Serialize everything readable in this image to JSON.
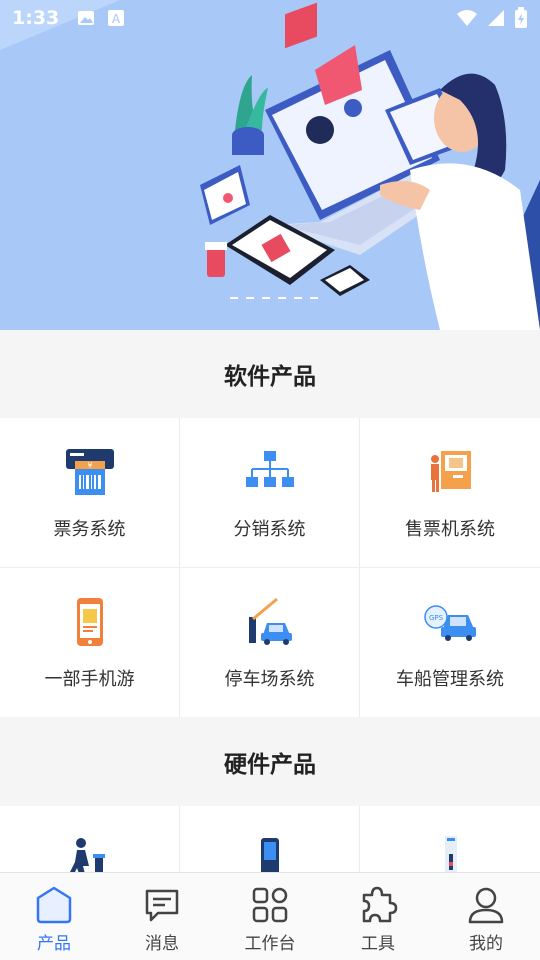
{
  "status_bar": {
    "time": "1:33"
  },
  "sections": {
    "software_title": "软件产品",
    "hardware_title": "硬件产品"
  },
  "software_products": [
    {
      "label": "票务系统",
      "icon": "ticket-printer-icon"
    },
    {
      "label": "分销系统",
      "icon": "org-tree-icon"
    },
    {
      "label": "售票机系统",
      "icon": "ticket-machine-icon"
    },
    {
      "label": "一部手机游",
      "icon": "mobile-phone-icon"
    },
    {
      "label": "停车场系统",
      "icon": "parking-barrier-icon"
    },
    {
      "label": "车船管理系统",
      "icon": "gps-car-icon"
    }
  ],
  "hardware_products": [
    {
      "icon": "turnstile-walker-icon"
    },
    {
      "icon": "handheld-terminal-icon"
    },
    {
      "icon": "gate-post-icon"
    }
  ],
  "tabs": [
    {
      "label": "产品",
      "icon": "home-icon",
      "active": true
    },
    {
      "label": "消息",
      "icon": "message-icon",
      "active": false
    },
    {
      "label": "工作台",
      "icon": "grid-icon",
      "active": false
    },
    {
      "label": "工具",
      "icon": "puzzle-icon",
      "active": false
    },
    {
      "label": "我的",
      "icon": "user-icon",
      "active": false
    }
  ],
  "colors": {
    "accent": "#3477f5",
    "banner_bg": "#a8c8f7",
    "orange": "#f5a04a"
  }
}
